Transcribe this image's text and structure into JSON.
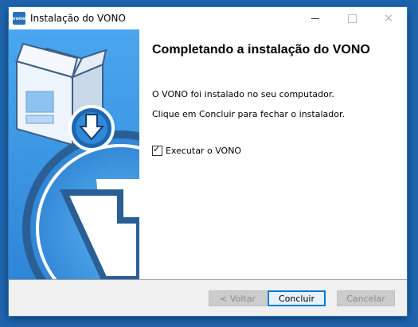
{
  "window": {
    "title": "Instalação do VONO",
    "app_icon_text": "vono"
  },
  "content": {
    "heading": "Completando a instalação do VONO",
    "message_installed": "O VONO foi instalado no seu computador.",
    "message_close": "Clique em Concluir para fechar o instalador.",
    "run_checkbox": {
      "label": "Executar o VONO",
      "checked": true
    }
  },
  "buttons": {
    "back": "< Voltar",
    "finish": "Concluir",
    "cancel": "Cancelar"
  },
  "colors": {
    "banner_blue": "#3f9be6",
    "desktop_blue": "#1e64ad",
    "focus_border": "#0078d7"
  }
}
